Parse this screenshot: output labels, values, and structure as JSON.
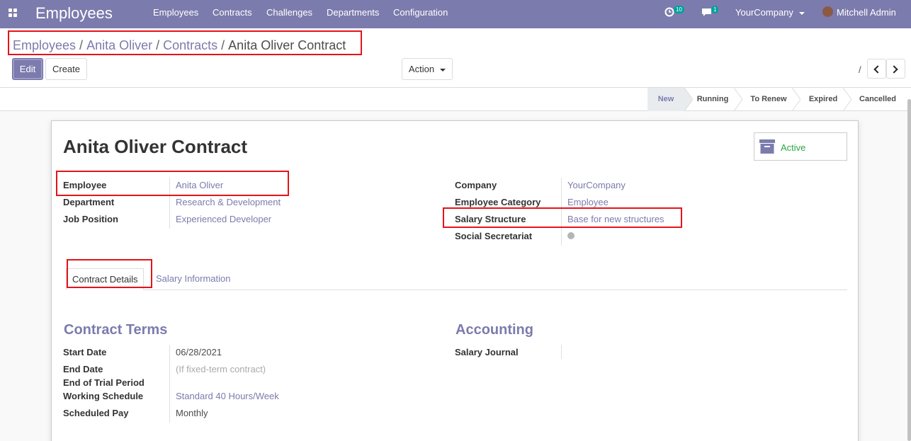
{
  "nav": {
    "app_title": "Employees",
    "menu": [
      "Employees",
      "Contracts",
      "Challenges",
      "Departments",
      "Configuration"
    ],
    "activity_count": "10",
    "message_count": "1",
    "company": "YourCompany",
    "user": "Mitchell Admin"
  },
  "breadcrumb": [
    "Employees",
    "Anita Oliver",
    "Contracts",
    "Anita Oliver Contract"
  ],
  "breadcrumb_sep": "/",
  "toolbar": {
    "edit_label": "Edit",
    "create_label": "Create",
    "action_label": "Action",
    "pager_value": "/"
  },
  "stages": [
    "New",
    "Running",
    "To Renew",
    "Expired",
    "Cancelled"
  ],
  "active_stage": "New",
  "record": {
    "title": "Anita Oliver Contract",
    "status_button": "Active",
    "left_fields": [
      {
        "label": "Employee",
        "value": "Anita Oliver"
      },
      {
        "label": "Department",
        "value": "Research & Development"
      },
      {
        "label": "Job Position",
        "value": "Experienced Developer"
      }
    ],
    "right_fields": [
      {
        "label": "Company",
        "value": "YourCompany"
      },
      {
        "label": "Employee Category",
        "value": "Employee"
      },
      {
        "label": "Salary Structure",
        "value": "Base for new structures"
      },
      {
        "label": "Social Secretariat",
        "value": ""
      }
    ]
  },
  "tabs": [
    "Contract Details",
    "Salary Information"
  ],
  "contract_terms": {
    "title": "Contract Terms",
    "fields": [
      {
        "label": "Start Date",
        "value": "06/28/2021"
      },
      {
        "label": "End Date",
        "value": "(If fixed-term contract)"
      },
      {
        "label": "End of Trial Period",
        "value": ""
      },
      {
        "label": "Working Schedule",
        "value": "Standard 40 Hours/Week"
      },
      {
        "label": "Scheduled Pay",
        "value": "Monthly"
      }
    ]
  },
  "accounting": {
    "title": "Accounting",
    "fields": [
      {
        "label": "Salary Journal",
        "value": ""
      }
    ]
  },
  "colors": {
    "brand": "#7c7bad",
    "highlight": "#e5131a",
    "active_green": "#28a745",
    "badge": "#00a09d"
  }
}
